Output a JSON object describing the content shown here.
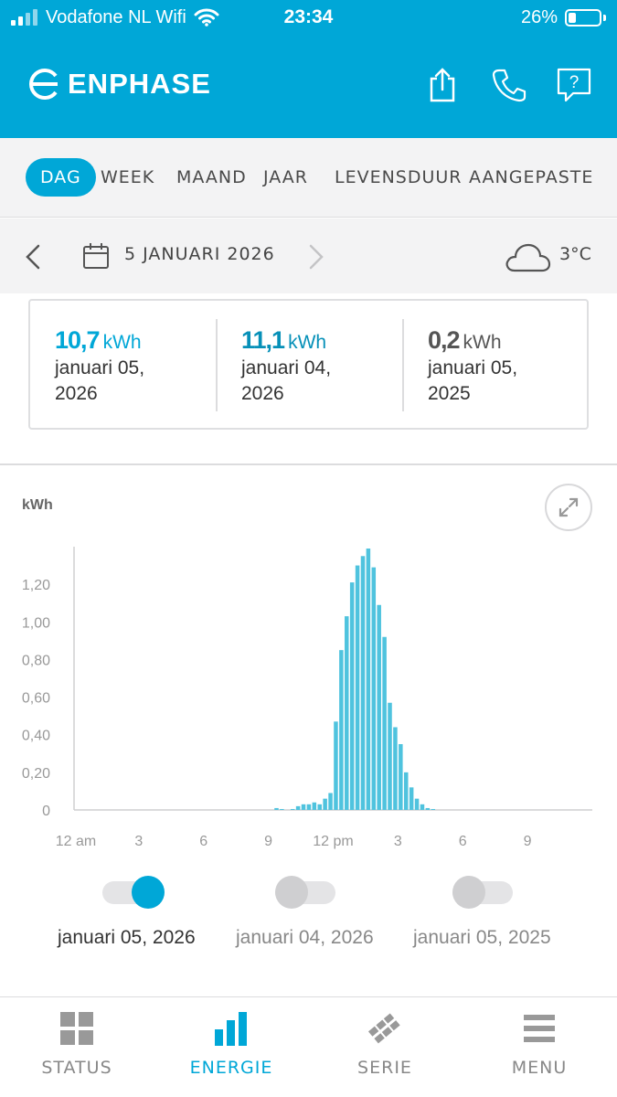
{
  "status_bar": {
    "carrier": "Vodafone NL Wifi",
    "time": "23:34",
    "battery": "26%",
    "battery_level": 0.26
  },
  "header": {
    "logo_text": "ENPHASE",
    "icons": [
      "share-icon",
      "phone-icon",
      "help-icon"
    ],
    "help_glyph": "?"
  },
  "tabs": [
    {
      "label": "DAG",
      "active": true
    },
    {
      "label": "WEEK",
      "active": false
    },
    {
      "label": "MAAND",
      "active": false
    },
    {
      "label": "JAAR",
      "active": false
    },
    {
      "label": "LEVENSDUUR",
      "active": false
    },
    {
      "label": "AANGEPASTE",
      "active": false
    }
  ],
  "date_nav": {
    "date": "5 JANUARI 2026",
    "weather_icon": "cloud-icon",
    "temperature": "3°C"
  },
  "summary": [
    {
      "value": "10,7",
      "unit": "kWh",
      "date_line1": "januari 05,",
      "date_line2": "2026",
      "color": "#00a7d7"
    },
    {
      "value": "11,1",
      "unit": "kWh",
      "date_line1": "januari 04,",
      "date_line2": "2026",
      "color": "#0690b8"
    },
    {
      "value": "0,2",
      "unit": "kWh",
      "date_line1": "januari 05,",
      "date_line2": "2025",
      "color": "#555555"
    }
  ],
  "chart_data": {
    "type": "bar",
    "ylabel": "kWh",
    "ylim": [
      0,
      1.4
    ],
    "yticks": [
      "0",
      "0,20",
      "0,40",
      "0,60",
      "0,80",
      "1,00",
      "1,20"
    ],
    "ytick_values": [
      0,
      0.2,
      0.4,
      0.6,
      0.8,
      1.0,
      1.2
    ],
    "xticks": [
      "12 am",
      "3",
      "6",
      "9",
      "12 pm",
      "3",
      "6",
      "9"
    ],
    "xtick_hours": [
      0,
      3,
      6,
      9,
      12,
      15,
      18,
      21
    ],
    "interval_minutes": 15,
    "bar_color": "#4fc3de",
    "series": [
      {
        "name": "januari 05, 2026",
        "x": [
          "09:15",
          "09:30",
          "10:00",
          "10:15",
          "10:30",
          "10:45",
          "11:00",
          "11:15",
          "11:30",
          "11:45",
          "12:00",
          "12:15",
          "12:30",
          "12:45",
          "13:00",
          "13:15",
          "13:30",
          "13:45",
          "14:00",
          "14:15",
          "14:30",
          "14:45",
          "15:00",
          "15:15",
          "15:30",
          "15:45",
          "16:00",
          "16:15",
          "16:30"
        ],
        "values": [
          0.01,
          0.005,
          0.005,
          0.02,
          0.03,
          0.03,
          0.04,
          0.03,
          0.06,
          0.09,
          0.47,
          0.85,
          1.03,
          1.21,
          1.3,
          1.35,
          1.39,
          1.29,
          1.09,
          0.92,
          0.57,
          0.44,
          0.35,
          0.2,
          0.12,
          0.06,
          0.03,
          0.01,
          0.005
        ]
      }
    ]
  },
  "legend": [
    {
      "label": "januari 05, 2026",
      "on": true
    },
    {
      "label": "januari 04, 2026",
      "on": false
    },
    {
      "label": "januari 05, 2025",
      "on": false
    }
  ],
  "bottom_nav": [
    {
      "label": "STATUS",
      "icon": "grid-icon",
      "active": false
    },
    {
      "label": "ENERGIE",
      "icon": "bar-chart-icon",
      "active": true
    },
    {
      "label": "SERIE",
      "icon": "solar-panel-icon",
      "active": false
    },
    {
      "label": "MENU",
      "icon": "hamburger-icon",
      "active": false
    }
  ],
  "colors": {
    "accent": "#00a7d7",
    "inactive": "#888888"
  }
}
